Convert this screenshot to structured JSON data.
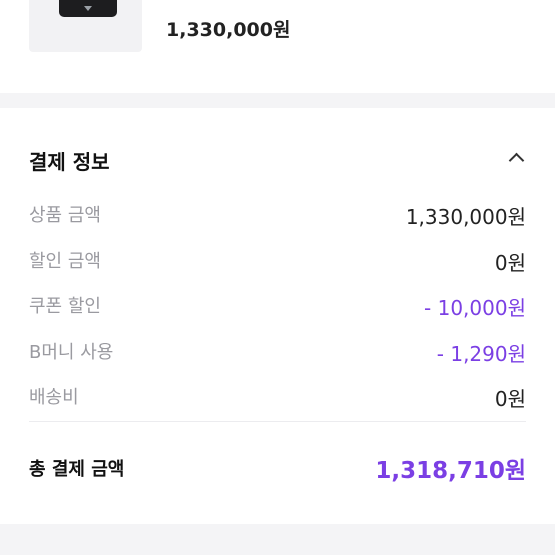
{
  "product": {
    "price": "1,330,000원"
  },
  "payment": {
    "title": "결제 정보",
    "rows": [
      {
        "label": "상품 금액",
        "value": "1,330,000원"
      },
      {
        "label": "할인 금액",
        "value": "0원"
      },
      {
        "label": "쿠폰 할인",
        "value": "- 10,000원"
      },
      {
        "label": "B머니 사용",
        "value": "- 1,290원"
      },
      {
        "label": "배송비",
        "value": "0원"
      }
    ],
    "total_label": "총 결제 금액",
    "total_value": "1,318,710원"
  },
  "colors": {
    "accent": "#7b3fe4",
    "section_background": "#f4f4f6"
  },
  "icons": {
    "collapse": "chevron-up-icon"
  }
}
